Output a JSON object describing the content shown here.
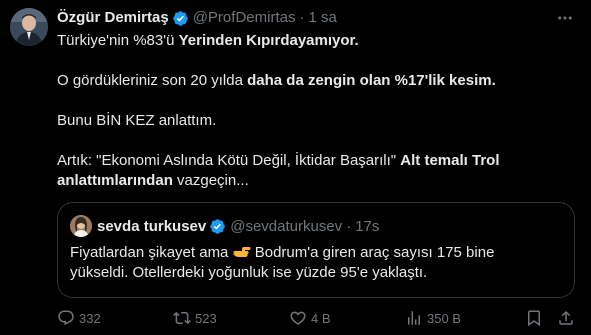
{
  "tweet": {
    "author_name": "Özgür Demirtaş",
    "handle": "@ProfDemirtas",
    "separator": "·",
    "time": "1 sa",
    "verified_color": "#1d9bf0",
    "lines": {
      "l1_a": "Türkiye'nin %83'ü ",
      "l1_b": "Yerinden Kıpırdayamıyor.",
      "l2_a": "O gördükleriniz son 20 yılda ",
      "l2_b": "daha da zengin olan %17'lik kesim.",
      "l3": "Bunu BİN KEZ anlattım.",
      "l4_a": "Artık: \"Ekonomi Aslında Kötü Değil, İktidar Başarılı\" ",
      "l4_b": "Alt temalı Trol",
      "l5_b": "anlattımlarından",
      "l5_a": " vazgeçin..."
    }
  },
  "quote": {
    "author_name": "sevda turkusev",
    "handle": "@sevdaturkusev",
    "separator": "·",
    "time": "17s",
    "line1_a": "Fiyatlardan şikayet ama ",
    "emoji": "pointing-hand-emoji",
    "line1_b": " Bodrum'a giren araç sayısı 175 bine",
    "line2": "yükseldi. Otellerdeki yoğunluk ise yüzde 95'e yaklaştı."
  },
  "actions": {
    "replies": "332",
    "reposts": "523",
    "likes": "4 B",
    "views": "350 B"
  },
  "colors": {
    "background": "#000000",
    "text": "#e7e9ea",
    "muted": "#71767b",
    "border": "#2f3336",
    "accent": "#1d9bf0"
  }
}
